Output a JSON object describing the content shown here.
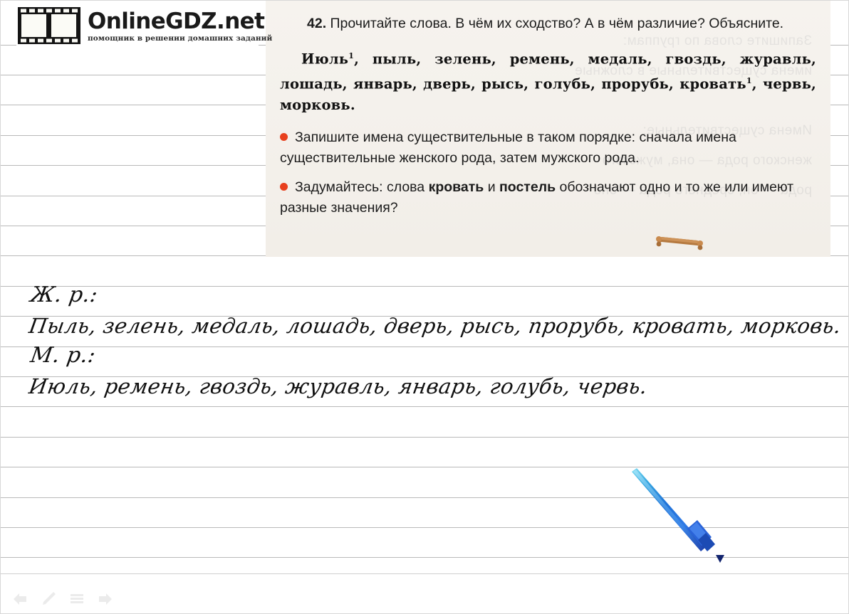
{
  "brand": {
    "title": "OnlineGDZ.net",
    "subtitle": "помощник в решении домашних заданий",
    "film_icon": "film-strip-icon"
  },
  "excerpt": {
    "exercise_number": "42.",
    "prompt": "Прочитайте слова. В чём их сходство? А в чём различие? Объясните.",
    "words_line": "Июль1, пыль, зелень, ремень, медаль, гвоздь, журавль, лошадь, январь, дверь, рысь, голубь, прорубь, кровать1, червь, морковь.",
    "words_html": "Июль<sup>1</sup>, пыль, зелень, ремень, медаль, гвоздь, журавль, лошадь, январь, дверь, рысь, голубь, прорубь, кровать<sup>1</sup>, червь, морковь.",
    "bullets": [
      {
        "marker": "red-dot-bullet",
        "text": "Запишите имена существительные в таком порядке: сначала имена существительные женского рода, затем мужского рода."
      },
      {
        "marker": "red-dot-bullet",
        "text_before": "Задумайтесь: слова ",
        "bold_1": "кровать",
        "text_middle": " и ",
        "bold_2": "постель",
        "text_after": " обозначают одно и то же или имеют разные значения?"
      }
    ],
    "ghost_text": "Запишите слова по группам:\nимена существительные в сложные\n\nИмена существительные:\nженского рода — она, мужского\nрода — он, среднего рода — оно",
    "bullet_color": "#e8401e",
    "paper_color": "#f4f1ec",
    "illustration": "wooden-bed-illustration"
  },
  "answer": {
    "fem_label": "Ж. р.:",
    "fem_words": "Пыль, зелень, медаль, лошадь, дверь, рысь, прорубь, кровать, морковь.",
    "masc_label": "М. р.:",
    "masc_words": "Июль, ремень, гвоздь, журавль, январь, голубь, червь."
  },
  "stylus": {
    "name": "blue-stylus-pen",
    "color_tip": "#5ec8e8",
    "color_body": "#1f5fd0",
    "color_grip": "#2b6fe0"
  },
  "toolbar": {
    "buttons": [
      {
        "name": "prev-arrow-icon",
        "glyph": "◄"
      },
      {
        "name": "pencil-icon",
        "glyph": "✎"
      },
      {
        "name": "list-lines-icon",
        "glyph": "▤"
      },
      {
        "name": "next-arrow-icon",
        "glyph": "►"
      }
    ]
  },
  "page": {
    "rule_color": "#b9b9b9",
    "background": "#ffffff"
  }
}
